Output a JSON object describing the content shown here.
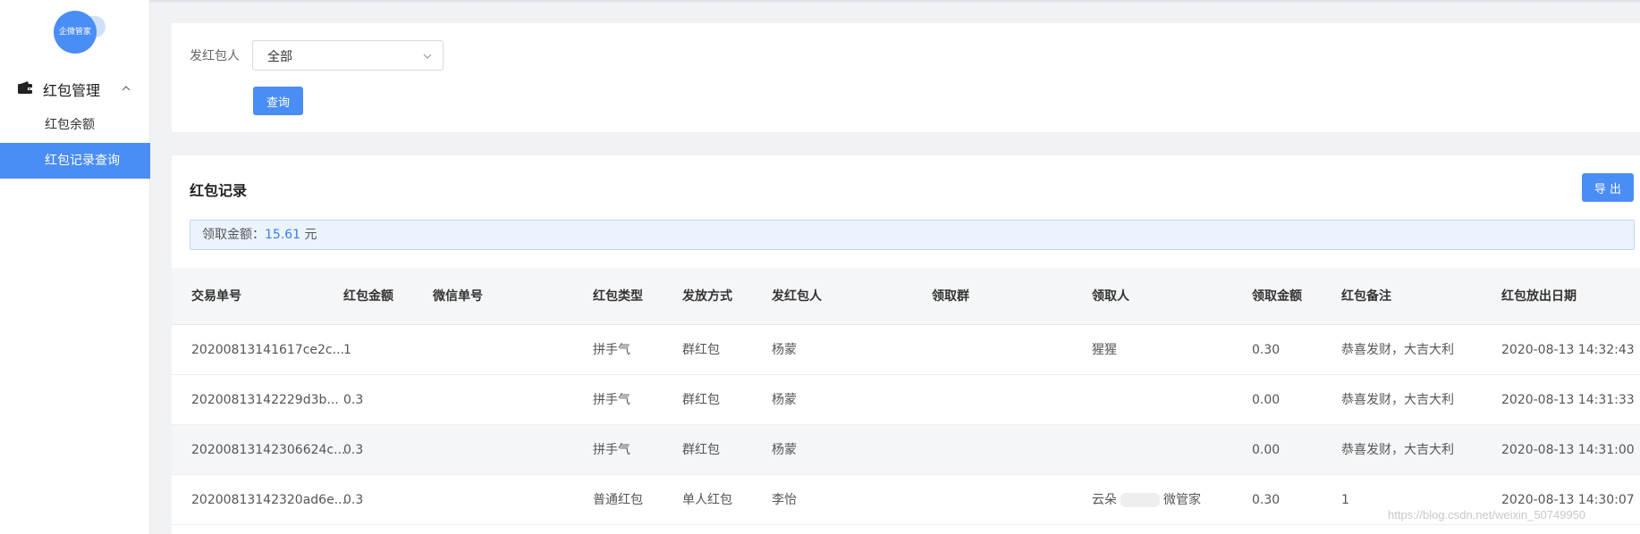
{
  "logo": {
    "text": "企微管家"
  },
  "sidebar": {
    "group_label": "红包管理",
    "items": [
      {
        "label": "红包余额"
      },
      {
        "label": "红包记录查询"
      }
    ]
  },
  "filter": {
    "label": "发红包人",
    "select_value": "全部",
    "query_label": "查询"
  },
  "records": {
    "title": "红包记录",
    "export_label": "导 出",
    "summary_label": "领取金额：",
    "summary_amount": "15.61",
    "summary_unit": " 元"
  },
  "table": {
    "headers": [
      "交易单号",
      "红包金额",
      "微信单号",
      "红包类型",
      "发放方式",
      "发红包人",
      "领取群",
      "领取人",
      "领取金额",
      "红包备注",
      "红包放出日期"
    ],
    "rows": [
      [
        "20200813141617ce2c...",
        "1",
        "",
        "拼手气",
        "群红包",
        "杨蒙",
        "",
        "猩猩",
        "0.30",
        "恭喜发财，大吉大利",
        "2020-08-13 14:32:43"
      ],
      [
        "20200813142229d3b...",
        "0.3",
        "",
        "拼手气",
        "群红包",
        "杨蒙",
        "",
        "",
        "0.00",
        "恭喜发财，大吉大利",
        "2020-08-13 14:31:33"
      ],
      [
        "20200813142306624c...",
        "0.3",
        "",
        "拼手气",
        "群红包",
        "杨蒙",
        "",
        "",
        "0.00",
        "恭喜发财，大吉大利",
        "2020-08-13 14:31:00"
      ],
      [
        "20200813142320ad6e...",
        "0.3",
        "",
        "普通红包",
        "单人红包",
        "李怡",
        "",
        "云朵",
        "0.30",
        "1",
        "2020-08-13 14:30:07"
      ]
    ],
    "row4_receiver_suffix": "微管家"
  },
  "watermark": "https://blog.csdn.net/weixin_50749950"
}
